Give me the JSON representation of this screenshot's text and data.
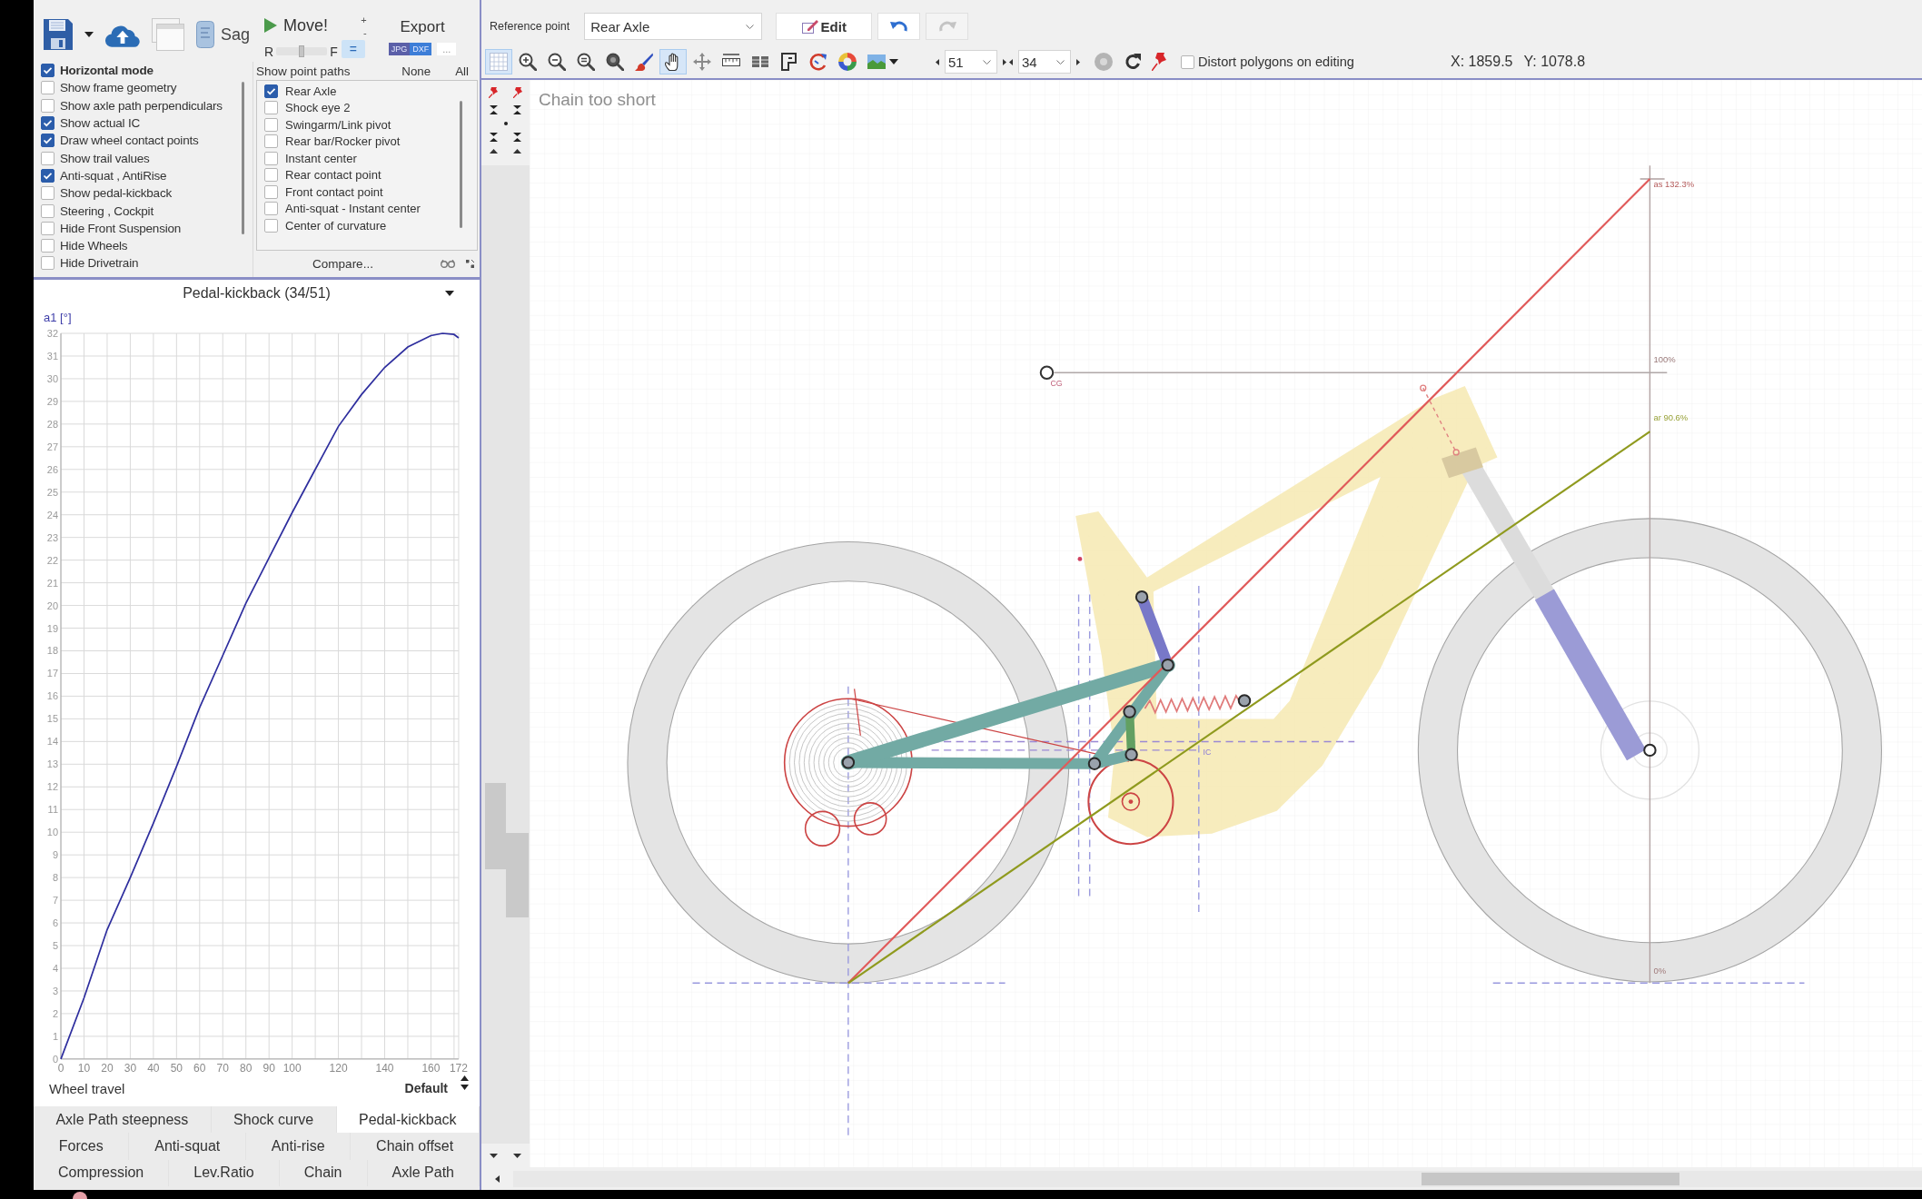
{
  "left_toolbar": {
    "sag": "Sag",
    "move": "Move!",
    "slider": {
      "left_label": "R",
      "right_label": "F",
      "level": 0.5
    },
    "step_up": "+",
    "step_down": "-",
    "equal": {
      "label": "=",
      "selected": true
    },
    "export": {
      "label": "Export",
      "formats": [
        "JPG",
        "DXF"
      ],
      "more": "..."
    }
  },
  "display_options": [
    {
      "label": "Horizontal mode",
      "checked": true,
      "bold": true
    },
    {
      "label": "Show frame geometry",
      "checked": false,
      "bold": false
    },
    {
      "label": "Show axle path perpendiculars",
      "checked": false,
      "bold": false
    },
    {
      "label": "Show actual IC",
      "checked": true,
      "bold": false
    },
    {
      "label": "Draw wheel contact points",
      "checked": true,
      "bold": false
    },
    {
      "label": "Show trail values",
      "checked": false,
      "bold": false
    },
    {
      "label": "Anti-squat , AntiRise",
      "checked": true,
      "bold": false
    },
    {
      "label": "Show pedal-kickback",
      "checked": false,
      "bold": false
    },
    {
      "label": "Steering , Cockpit",
      "checked": false,
      "bold": false
    },
    {
      "label": "Hide Front Suspension",
      "checked": false,
      "bold": false
    },
    {
      "label": "Hide Wheels",
      "checked": false,
      "bold": false
    },
    {
      "label": "Hide Drivetrain",
      "checked": false,
      "bold": false
    }
  ],
  "point_paths": {
    "title": "Show point paths",
    "none": "None",
    "all": "All",
    "items": [
      {
        "label": "Rear Axle",
        "checked": true
      },
      {
        "label": "Shock eye 2",
        "checked": false
      },
      {
        "label": "Swingarm/Link pivot",
        "checked": false
      },
      {
        "label": "Rear bar/Rocker pivot",
        "checked": false
      },
      {
        "label": "Instant center",
        "checked": false
      },
      {
        "label": "Rear contact point",
        "checked": false
      },
      {
        "label": "Front contact point",
        "checked": false
      },
      {
        "label": "Anti-squat - Instant center",
        "checked": false
      },
      {
        "label": "Center of curvature",
        "checked": false
      }
    ],
    "compare": "Compare..."
  },
  "chart_panel": {
    "chart_data": {
      "type": "line",
      "title": "Pedal-kickback (34/51)",
      "xlabel": "Wheel travel",
      "ylabel": "a1 [°]",
      "grid": true,
      "x": [
        0,
        10,
        20,
        30,
        40,
        50,
        60,
        70,
        80,
        90,
        100,
        110,
        120,
        130,
        140,
        150,
        160,
        165,
        170,
        172
      ],
      "series": [
        {
          "color": "#2e2e9e",
          "values": [
            0,
            2.7,
            5.7,
            8.0,
            10.4,
            12.9,
            15.5,
            17.8,
            20.1,
            22.1,
            24.1,
            26.0,
            27.9,
            29.3,
            30.5,
            31.4,
            31.9,
            32.0,
            31.95,
            31.8
          ]
        }
      ],
      "xlim": [
        0,
        172
      ],
      "ylim": [
        0,
        32
      ],
      "xticks": [
        0,
        10,
        20,
        30,
        40,
        50,
        60,
        70,
        80,
        90,
        100,
        120,
        140,
        160,
        172
      ],
      "yticks": [
        0,
        1,
        2,
        3,
        4,
        5,
        6,
        7,
        8,
        9,
        10,
        11,
        12,
        13,
        14,
        15,
        16,
        17,
        18,
        19,
        20,
        21,
        22,
        23,
        24,
        25,
        26,
        27,
        28,
        29,
        30,
        31,
        32
      ]
    },
    "preset": "Default"
  },
  "chart_tabs": [
    {
      "tabs": [
        {
          "label": "Axle Path steepness",
          "selected": false
        },
        {
          "label": "Shock curve",
          "selected": false
        },
        {
          "label": "Pedal-kickback",
          "selected": true
        }
      ]
    },
    {
      "tabs": [
        {
          "label": "Forces",
          "selected": false
        },
        {
          "label": "Anti-squat",
          "selected": false
        },
        {
          "label": "Anti-rise",
          "selected": false
        },
        {
          "label": "Chain offset",
          "selected": false
        }
      ]
    },
    {
      "tabs": [
        {
          "label": "Compression",
          "selected": false
        },
        {
          "label": "Lev.Ratio",
          "selected": false
        },
        {
          "label": "Chain",
          "selected": false
        },
        {
          "label": "Axle Path",
          "selected": false
        }
      ]
    }
  ],
  "toolbar": {
    "reference_label": "Reference point",
    "reference_value": "Rear Axle",
    "edit": "Edit",
    "undo": {
      "disabled": false
    },
    "redo": {
      "disabled": true
    },
    "tools": [
      {
        "selected": true
      },
      {
        "selected": false
      },
      {
        "selected": false
      },
      {
        "selected": false
      },
      {
        "selected": false
      },
      {
        "selected": false
      },
      {
        "selected": true
      },
      {
        "selected": false
      },
      {
        "selected": false
      },
      {
        "selected": false
      },
      {
        "selected": false
      },
      {
        "selected": false
      },
      {
        "selected": false
      },
      {
        "selected": false
      }
    ],
    "spinners": [
      {
        "value": "51"
      },
      {
        "value": "34"
      }
    ],
    "distort": {
      "label": "Distort polygons on editing",
      "checked": false
    },
    "coordinates": [
      "X: 1859.5",
      "Y: 1078.8"
    ]
  },
  "canvas": {
    "warning": "Chain too short",
    "labels": [
      {
        "kind": "anti_squat",
        "text": "as 132.3%"
      },
      {
        "kind": "scale_full",
        "text": "100%"
      },
      {
        "kind": "anti_rise",
        "text": "ar 90.6%"
      },
      {
        "kind": "scale_zero",
        "text": "0%"
      },
      {
        "kind": "cg",
        "text": "CG"
      },
      {
        "kind": "ic",
        "text": "IC"
      }
    ]
  }
}
